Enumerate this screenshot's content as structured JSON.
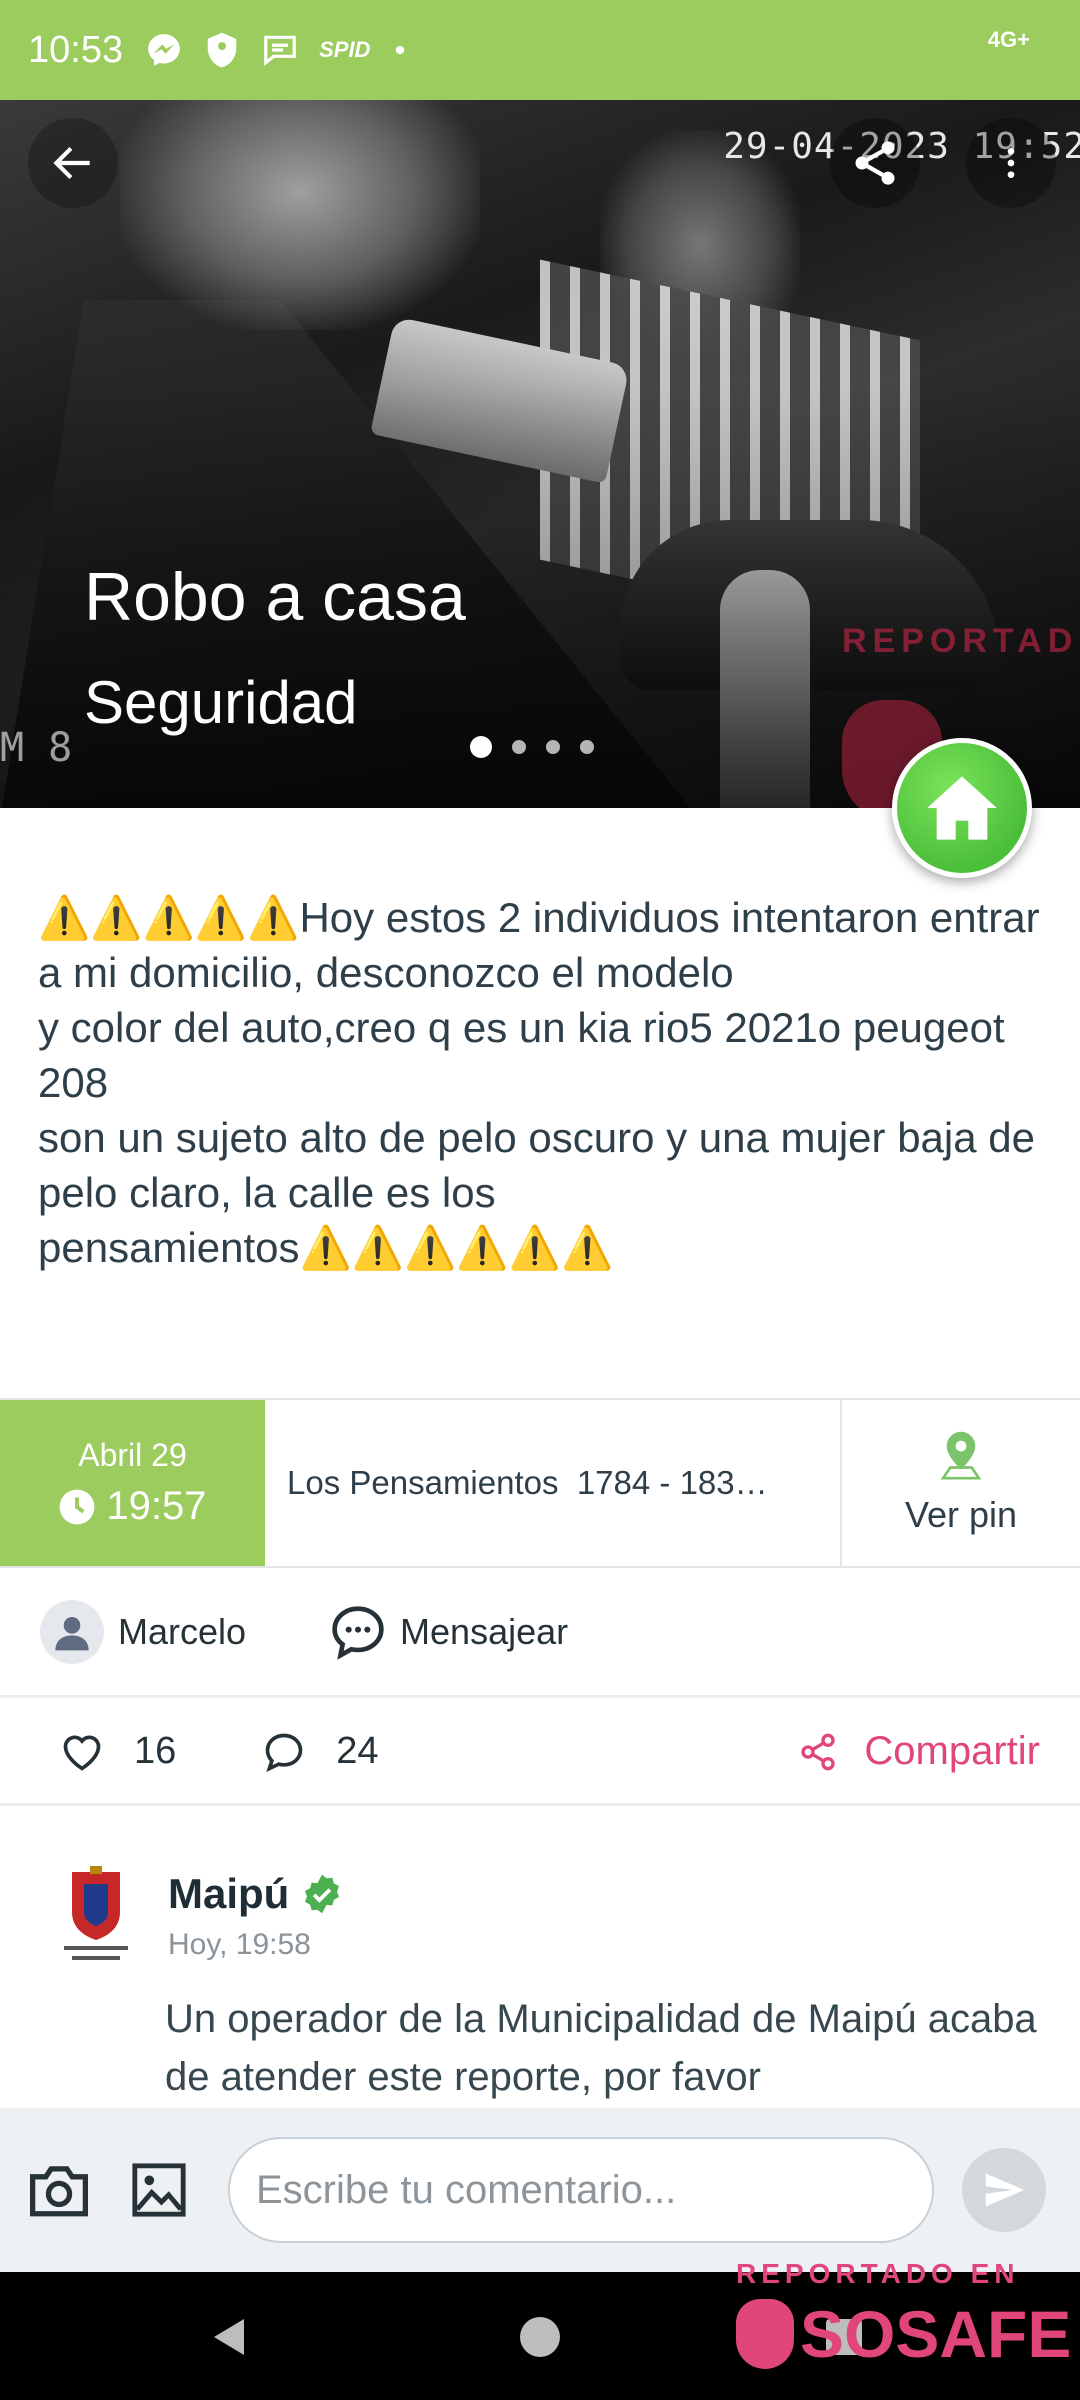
{
  "status_bar": {
    "time": "10:53",
    "spid_label": "SPID",
    "network": "4G+"
  },
  "hero": {
    "title": "Robo a casa",
    "subtitle": "Seguridad",
    "timestamp_overlay": "29-04-2023  19:52",
    "camera_label": "M 8",
    "watermark": "REPORTAD",
    "carousel_pages": 4,
    "carousel_active": 1
  },
  "description": "⚠️⚠️⚠️⚠️⚠️Hoy estos 2 individuos intentaron entrar a mi domicilio, desconozco el modelo\ny color del auto,creo q es un kia rio5 2021o peugeot 208\nson un sujeto alto de pelo oscuro y una mujer baja de pelo claro, la calle es los pensamientos⚠️⚠️⚠️⚠️⚠️⚠️",
  "info": {
    "date": "Abril 29",
    "time": "19:57",
    "address": "Los Pensamientos  1784 - 183…",
    "pin_label": "Ver pin"
  },
  "author": {
    "name": "Marcelo",
    "message_label": "Mensajear"
  },
  "actions": {
    "likes": "16",
    "comments": "24",
    "share_label": "Compartir"
  },
  "comment": {
    "author": "Maipú",
    "time": "Hoy, 19:58",
    "text": "Un operador de la Municipalidad de Maipú acaba de atender este reporte, por favor"
  },
  "composer": {
    "placeholder": "Escribe tu comentario..."
  },
  "watermark_footer": {
    "small": "REPORTADO EN",
    "big": "SOSAFE"
  },
  "colors": {
    "brand_green": "#9ccb5e",
    "fab_green": "#4cbf3a",
    "accent_pink": "#e0457b"
  }
}
